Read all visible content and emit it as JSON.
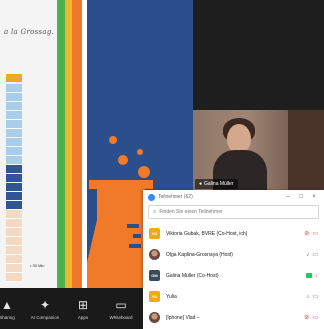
{
  "shared_document": {
    "handwriting": "a la Grossag.",
    "column_colors": [
      "#a9cdea",
      "#a9cdea",
      "#a9cdea",
      "#a9cdea",
      "#a9cdea",
      "#a9cdea",
      "#a9cdea",
      "#a9cdea",
      "#a9cdea",
      "#2f5596",
      "#2f5596",
      "#2f5596",
      "#2f5596",
      "#2f5596",
      "#f4d9c5",
      "#f4d9c5",
      "#f4d9c5",
      "#f4d9c5",
      "#f4d9c5",
      "#f4d9c5",
      "#f4d9c5",
      "#f4d9c5"
    ],
    "tab_color": "#f0a81e",
    "note": "• 30 Min"
  },
  "slide": {
    "stripe_colors": [
      "#4bb04c",
      "#f3b52d",
      "#ec7a2a",
      "#ffffff"
    ],
    "background": "#2b4f8c",
    "icon": "beaker-icon",
    "icon_color": "#f07a29"
  },
  "video_tile": {
    "name": "Galina Müller"
  },
  "participants_panel": {
    "title": "Teilnehmer (62)",
    "window_controls": [
      "–",
      "□",
      "×"
    ],
    "search_placeholder": "Finden Sie einen Teilnehmer",
    "participants": [
      {
        "name": "Viktoria Gubak, BVRE (Co-Host, ich)",
        "avatar": "VG",
        "avatar_color": "#f0a81e",
        "video": "off",
        "mic": "off"
      },
      {
        "name": "Olga Kaplina-Grosnaya (Host)",
        "avatar": "",
        "avatar_color": "#9e9e9e",
        "video": "off",
        "mic": "on"
      },
      {
        "name": "Galina Müller (Co-Host)",
        "avatar": "GM",
        "avatar_color": "#3b4a5a",
        "video": "on",
        "mic": "on"
      },
      {
        "name": "Yulia",
        "avatar": "YU",
        "avatar_color": "#f0a81e",
        "video": "off",
        "mic": "on"
      },
      {
        "name": "[Iphone] Vlad –",
        "avatar": "",
        "avatar_color": "#7b57c5",
        "video": "off",
        "mic": "off"
      }
    ]
  },
  "toolbar": {
    "buttons": [
      {
        "label": "Sharing",
        "icon": "share-icon",
        "glyph": "▲"
      },
      {
        "label": "AI Companion",
        "icon": "ai-companion-icon",
        "glyph": "✦"
      },
      {
        "label": "Apps",
        "icon": "apps-icon",
        "glyph": "⊞"
      },
      {
        "label": "Whiteboard",
        "icon": "whiteboard-icon",
        "glyph": "▭"
      }
    ]
  }
}
